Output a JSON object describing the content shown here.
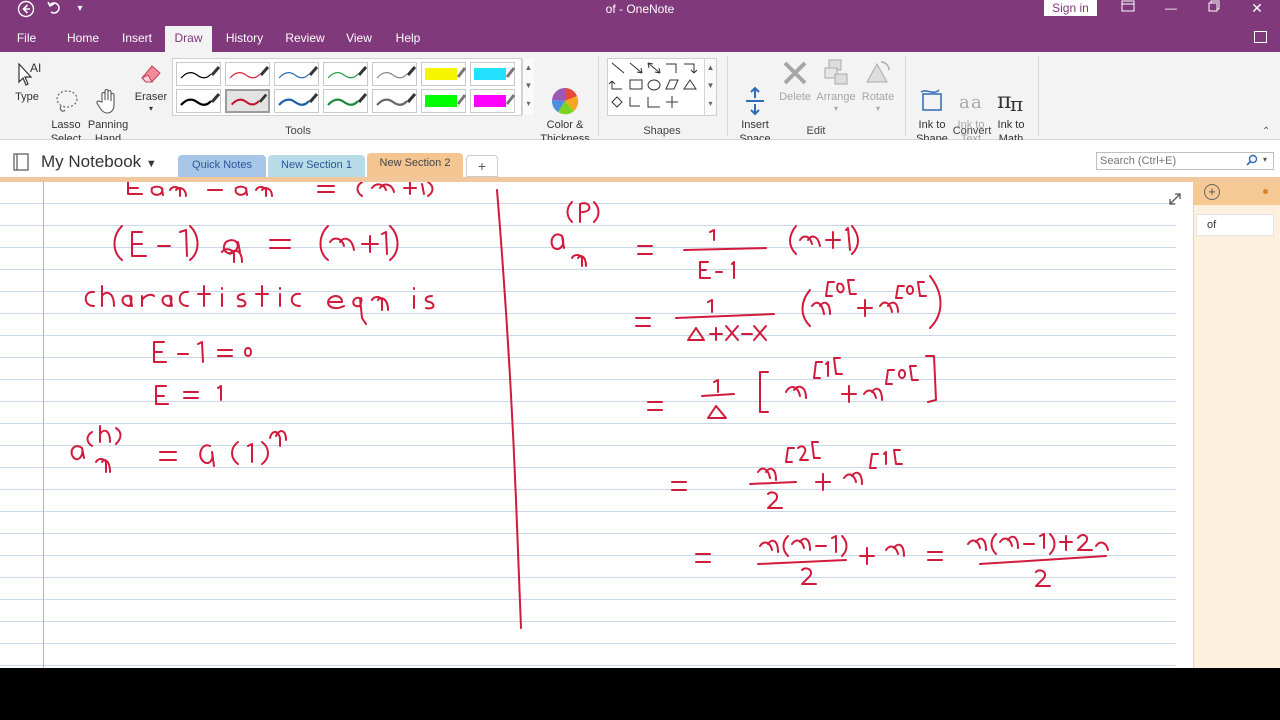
{
  "window": {
    "title": "of  -  OneNote",
    "sign_in": "Sign in"
  },
  "ribbon_tabs": [
    "File",
    "Home",
    "Insert",
    "Draw",
    "History",
    "Review",
    "View",
    "Help"
  ],
  "active_tab": "Draw",
  "ribbon": {
    "tools": {
      "type_label": "Type",
      "lasso_label": "Lasso\nSelect",
      "panning_label": "Panning\nHand",
      "eraser_label": "Eraser",
      "group_label": "Tools"
    },
    "color_thickness_label": "Color &\nThickness",
    "shapes_group_label": "Shapes",
    "edit": {
      "insert_space_label": "Insert\nSpace",
      "delete_label": "Delete",
      "arrange_label": "Arrange",
      "rotate_label": "Rotate",
      "group_label": "Edit"
    },
    "convert": {
      "ink_to_shape_label": "Ink to\nShape",
      "ink_to_text_label": "Ink to\nText",
      "ink_to_math_label": "Ink to\nMath",
      "group_label": "Convert"
    },
    "pen_colors": [
      "#000000",
      "#d9213b",
      "#2e6bb5",
      "#2e9a47",
      "#888888",
      "#f5f500",
      "#22e0ff",
      "#000000",
      "#c4132f",
      "#1f5fa8",
      "#1b8a3b",
      "#666666",
      "#00ff00",
      "#ff00ff"
    ]
  },
  "notebook": {
    "name": "My Notebook",
    "sections": [
      "Quick Notes",
      "New Section 1",
      "New Section 2"
    ],
    "section_colors": [
      "#a8c6e8",
      "#b7dbe7",
      "#f4c591"
    ],
    "add_section": "+"
  },
  "search": {
    "placeholder": "Search (Ctrl+E)"
  },
  "pages_pane": {
    "pages": [
      "of"
    ]
  },
  "colors": {
    "accent": "#80397b",
    "ink": "#d11a3c"
  }
}
